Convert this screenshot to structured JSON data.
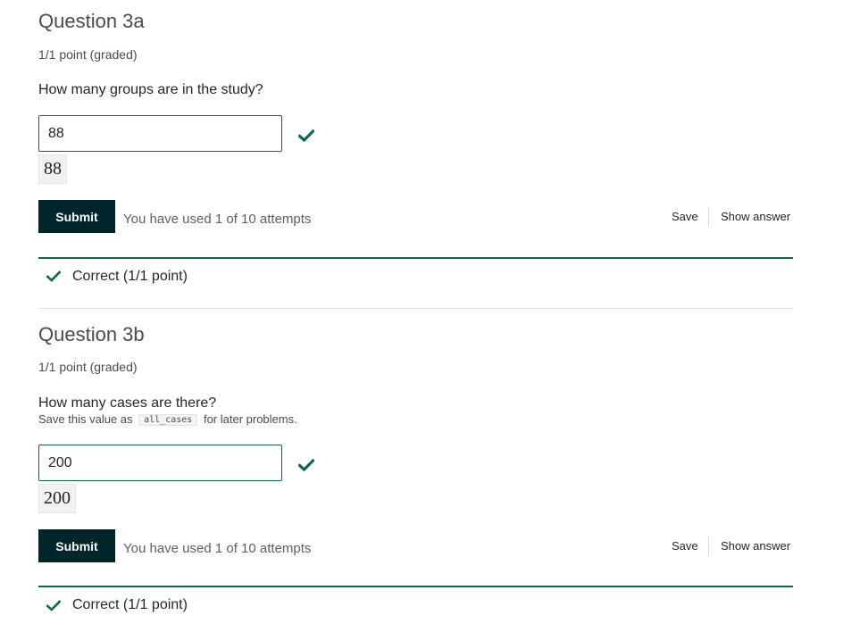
{
  "problems": [
    {
      "title": "Question 3a",
      "meta": "1/1 point (graded)",
      "prompt": "How many groups are in the study?",
      "answer_value": "88",
      "preview": "88",
      "submit_label": "Submit",
      "attempts_text": "You have used 1 of 10 attempts",
      "save_label": "Save",
      "show_answer_label": "Show answer",
      "feedback": "Correct (1/1 point)"
    },
    {
      "title": "Question 3b",
      "meta": "1/1 point (graded)",
      "prompt": "How many cases are there?",
      "hint_before": "Save this value as",
      "hint_code": "all_cases",
      "hint_after": "for later problems.",
      "answer_value": "200",
      "preview": "200",
      "submit_label": "Submit",
      "attempts_text": "You have used 1 of 10 attempts",
      "save_label": "Save",
      "show_answer_label": "Show answer",
      "feedback": "Correct (1/1 point)"
    }
  ],
  "colors": {
    "correct_green": "#0e6b4a",
    "submit_bg": "#00262b"
  },
  "icons": {
    "status": "check-icon",
    "feedback": "check-icon"
  }
}
